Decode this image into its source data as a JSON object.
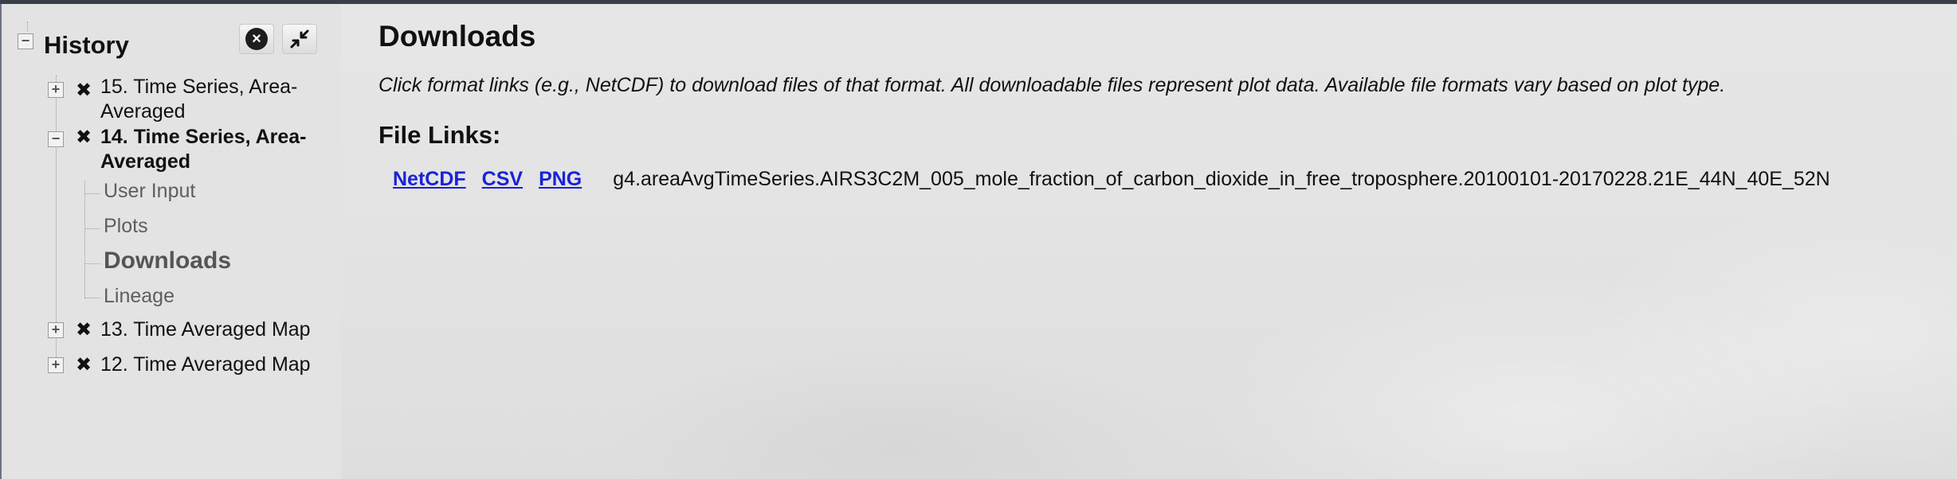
{
  "sidebar": {
    "title": "History",
    "collapse_icon_glyph": "−",
    "items": [
      {
        "number_title": "15. Time Series, Area-",
        "title_cont": "Averaged",
        "expanded": false,
        "toggle_glyph": "+"
      },
      {
        "number_title": "14. Time Series, Area-",
        "title_cont": "Averaged",
        "expanded": true,
        "toggle_glyph": "−",
        "children": [
          {
            "label": "User Input"
          },
          {
            "label": "Plots"
          },
          {
            "label": "Downloads",
            "active": true
          },
          {
            "label": "Lineage"
          }
        ]
      },
      {
        "number_title": "13. Time Averaged Map",
        "expanded": false,
        "toggle_glyph": "+"
      },
      {
        "number_title": "12. Time Averaged Map",
        "expanded": false,
        "toggle_glyph": "+"
      }
    ],
    "icons": {
      "close_all": "close-circle-icon",
      "minimize": "collapse-arrows-icon",
      "delete": "x-icon"
    }
  },
  "main": {
    "title": "Downloads",
    "instructions": "Click format links (e.g., NetCDF) to download files of that format. All downloadable files represent plot data. Available file formats vary based on plot type.",
    "file_links_heading": "File Links:",
    "formats": [
      "NetCDF",
      "CSV",
      "PNG"
    ],
    "file_name": "g4.areaAvgTimeSeries.AIRS3C2M_005_mole_fraction_of_carbon_dioxide_in_free_troposphere.20100101-20170228.21E_44N_40E_52N"
  },
  "colors": {
    "link": "#1a22d8",
    "sidebar_bg": "#e3e3e3",
    "main_bg": "#e4e4e4",
    "text": "#111111"
  }
}
